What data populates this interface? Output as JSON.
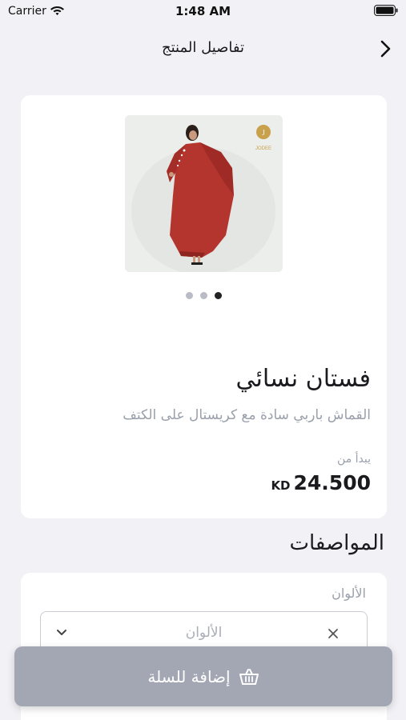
{
  "status_bar": {
    "carrier": "Carrier",
    "time": "1:48 AM"
  },
  "nav": {
    "title": "تفاصيل المنتج",
    "back_icon": "chevron-right-icon"
  },
  "product": {
    "image_alt_icon": "product-photo",
    "image_count": 3,
    "active_image_index": 2,
    "name": "فستان نسائي",
    "description": "القماش باربي سادة مع كريستال على الكتف",
    "price_caption": "يبدأ من",
    "price_value": "24.500",
    "price_currency": "KD"
  },
  "specs": {
    "heading": "المواصفات",
    "colors_label": "الألوان",
    "colors_placeholder": "الألوان"
  },
  "cart": {
    "button_label": "إضافة للسلة",
    "icon": "basket-icon"
  },
  "colors": {
    "background": "#f2f2f6",
    "card": "#ffffff",
    "button": "#a3a7b4",
    "muted_text": "#9aa0ab",
    "dress": "#b4342e"
  }
}
